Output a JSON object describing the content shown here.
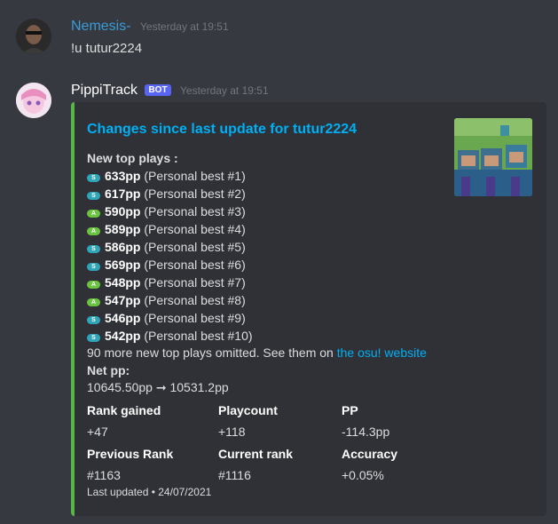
{
  "messages": [
    {
      "author": "Nemesis-",
      "author_color": "#3b9cd8",
      "timestamp": "Yesterday at 19:51",
      "content": "!u tutur2224"
    },
    {
      "author": "PippiTrack",
      "author_color": "#ffffff",
      "badge": "BOT",
      "timestamp": "Yesterday at 19:51"
    }
  ],
  "embed": {
    "accent_color": "#57b848",
    "title": "Changes since last update for tutur2224",
    "thumbnail_icon": "minecraft-steve-image",
    "top_plays_label": "New top plays :",
    "plays": [
      {
        "grade": "S",
        "pp": "633pp",
        "note": "(Personal best #1)"
      },
      {
        "grade": "S",
        "pp": "617pp",
        "note": "(Personal best #2)"
      },
      {
        "grade": "A",
        "pp": "590pp",
        "note": "(Personal best #3)"
      },
      {
        "grade": "A",
        "pp": "589pp",
        "note": "(Personal best #4)"
      },
      {
        "grade": "S",
        "pp": "586pp",
        "note": "(Personal best #5)"
      },
      {
        "grade": "S",
        "pp": "569pp",
        "note": "(Personal best #6)"
      },
      {
        "grade": "A",
        "pp": "548pp",
        "note": "(Personal best #7)"
      },
      {
        "grade": "A",
        "pp": "547pp",
        "note": "(Personal best #8)"
      },
      {
        "grade": "S",
        "pp": "546pp",
        "note": "(Personal best #9)"
      },
      {
        "grade": "S",
        "pp": "542pp",
        "note": "(Personal best #10)"
      }
    ],
    "omitted_text": "90 more new top plays omitted. See them on ",
    "omitted_link": "the osu! website",
    "net_pp_label": "Net pp:",
    "net_pp_value": "10645.50pp ➞ 10531.2pp",
    "fields": [
      {
        "name": "Rank gained",
        "value": "+47"
      },
      {
        "name": "Playcount",
        "value": "+118"
      },
      {
        "name": "PP",
        "value": "-114.3pp"
      },
      {
        "name": "Previous Rank",
        "value": "#1163"
      },
      {
        "name": "Current rank",
        "value": "#1116"
      },
      {
        "name": "Accuracy",
        "value": "+0.05%"
      }
    ],
    "footer": "Last updated • 24/07/2021"
  }
}
